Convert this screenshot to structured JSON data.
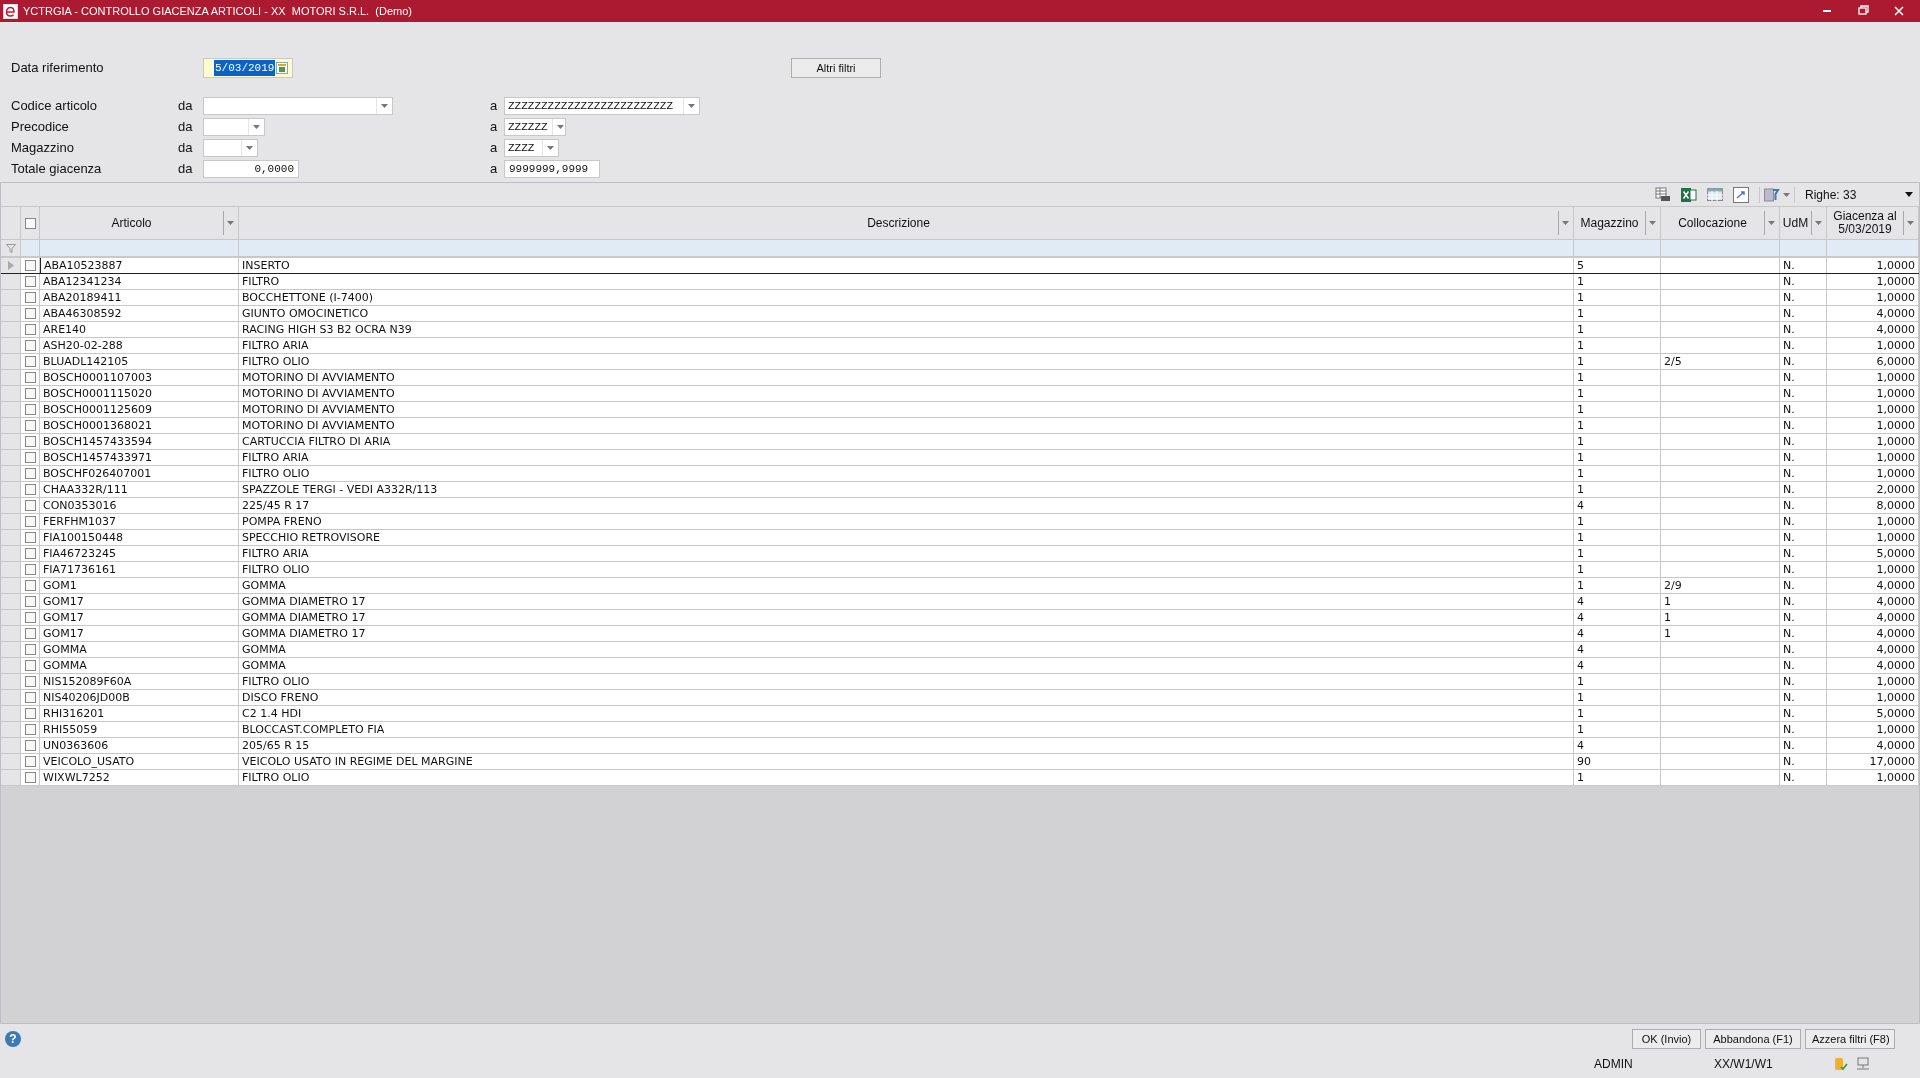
{
  "window": {
    "title": "YCTRGIA - CONTROLLO GIACENZA ARTICOLI - XX  MOTORI S.R.L.  (Demo)"
  },
  "date_field": {
    "label": "Data riferimento",
    "value": "5/03/2019"
  },
  "other_filters_button": "Altri filtri",
  "filters": [
    {
      "label": "Codice articolo",
      "from_label": "da",
      "from": {
        "kind": "combo"
      },
      "to_label": "a",
      "to": {
        "kind": "combo",
        "value": "ZZZZZZZZZZZZZZZZZZZZZZZZZ"
      }
    },
    {
      "label": "Precodice",
      "from_label": "da",
      "from": {
        "kind": "combo"
      },
      "to_label": "a",
      "to": {
        "kind": "combo",
        "value": "ZZZZZZ"
      }
    },
    {
      "label": "Magazzino",
      "from_label": "da",
      "from": {
        "kind": "combo"
      },
      "to_label": "a",
      "to": {
        "kind": "combo",
        "value": "ZZZZ"
      }
    },
    {
      "label": "Totale giacenza",
      "from_label": "da",
      "from": {
        "kind": "number",
        "value": "0,0000"
      },
      "to_label": "a",
      "to": {
        "kind": "text",
        "value": "9999999,9999"
      }
    }
  ],
  "grid_toolbar": {
    "rows_label": "Righe: 33"
  },
  "table": {
    "select_all_checked": false,
    "columns": [
      "Articolo",
      "Descrizione",
      "Magazzino",
      "Collocazione",
      "UdM",
      "Giacenza al 5/03/2019"
    ],
    "rows": [
      {
        "current": true,
        "checked": false,
        "cells": [
          "ABA10523887",
          "INSERTO",
          "5",
          "",
          "N.",
          "1,0000"
        ]
      },
      {
        "current": false,
        "checked": false,
        "cells": [
          "ABA12341234",
          "FILTRO",
          "1",
          "",
          "N.",
          "1,0000"
        ]
      },
      {
        "current": false,
        "checked": false,
        "cells": [
          "ABA20189411",
          "BOCCHETTONE (I-7400)",
          "1",
          "",
          "N.",
          "1,0000"
        ]
      },
      {
        "current": false,
        "checked": false,
        "cells": [
          "ABA46308592",
          "GIUNTO OMOCINETICO",
          "1",
          "",
          "N.",
          "4,0000"
        ]
      },
      {
        "current": false,
        "checked": false,
        "cells": [
          "ARE140",
          "RACING HIGH S3 B2 OCRA N39",
          "1",
          "",
          "N.",
          "4,0000"
        ]
      },
      {
        "current": false,
        "checked": false,
        "cells": [
          "ASH20-02-288",
          "FILTRO ARIA",
          "1",
          "",
          "N.",
          "1,0000"
        ]
      },
      {
        "current": false,
        "checked": false,
        "cells": [
          "BLUADL142105",
          "FILTRO OLIO",
          "1",
          "2/5",
          "N.",
          "6,0000"
        ]
      },
      {
        "current": false,
        "checked": false,
        "cells": [
          "BOSCH0001107003",
          "MOTORINO DI AVVIAMENTO",
          "1",
          "",
          "N.",
          "1,0000"
        ]
      },
      {
        "current": false,
        "checked": false,
        "cells": [
          "BOSCH0001115020",
          "MOTORINO DI AVVIAMENTO",
          "1",
          "",
          "N.",
          "1,0000"
        ]
      },
      {
        "current": false,
        "checked": false,
        "cells": [
          "BOSCH0001125609",
          "MOTORINO DI AVVIAMENTO",
          "1",
          "",
          "N.",
          "1,0000"
        ]
      },
      {
        "current": false,
        "checked": false,
        "cells": [
          "BOSCH0001368021",
          "MOTORINO DI AVVIAMENTO",
          "1",
          "",
          "N.",
          "1,0000"
        ]
      },
      {
        "current": false,
        "checked": false,
        "cells": [
          "BOSCH1457433594",
          "CARTUCCIA FILTRO DI ARIA",
          "1",
          "",
          "N.",
          "1,0000"
        ]
      },
      {
        "current": false,
        "checked": false,
        "cells": [
          "BOSCH1457433971",
          "FILTRO ARIA",
          "1",
          "",
          "N.",
          "1,0000"
        ]
      },
      {
        "current": false,
        "checked": false,
        "cells": [
          "BOSCHF026407001",
          "FILTRO OLIO",
          "1",
          "",
          "N.",
          "1,0000"
        ]
      },
      {
        "current": false,
        "checked": false,
        "cells": [
          "CHAA332R/111",
          "SPAZZOLE TERGI - VEDI A332R/113",
          "1",
          "",
          "N.",
          "2,0000"
        ]
      },
      {
        "current": false,
        "checked": false,
        "cells": [
          "CON0353016",
          "225/45 R 17",
          "4",
          "",
          "N.",
          "8,0000"
        ]
      },
      {
        "current": false,
        "checked": false,
        "cells": [
          "FERFHM1037",
          "POMPA FRENO",
          "1",
          "",
          "N.",
          "1,0000"
        ]
      },
      {
        "current": false,
        "checked": false,
        "cells": [
          "FIA100150448",
          "SPECCHIO RETROVISORE",
          "1",
          "",
          "N.",
          "1,0000"
        ]
      },
      {
        "current": false,
        "checked": false,
        "cells": [
          "FIA46723245",
          "FILTRO ARIA",
          "1",
          "",
          "N.",
          "5,0000"
        ]
      },
      {
        "current": false,
        "checked": false,
        "cells": [
          "FIA71736161",
          "FILTRO OLIO",
          "1",
          "",
          "N.",
          "1,0000"
        ]
      },
      {
        "current": false,
        "checked": false,
        "cells": [
          "GOM1",
          "GOMMA",
          "1",
          "2/9",
          "N.",
          "4,0000"
        ]
      },
      {
        "current": false,
        "checked": false,
        "cells": [
          "GOM17",
          "GOMMA DIAMETRO 17",
          "4",
          "1",
          "N.",
          "4,0000"
        ]
      },
      {
        "current": false,
        "checked": false,
        "cells": [
          "GOM17",
          "GOMMA DIAMETRO 17",
          "4",
          "1",
          "N.",
          "4,0000"
        ]
      },
      {
        "current": false,
        "checked": false,
        "cells": [
          "GOM17",
          "GOMMA DIAMETRO 17",
          "4",
          "1",
          "N.",
          "4,0000"
        ]
      },
      {
        "current": false,
        "checked": false,
        "cells": [
          "GOMMA",
          "GOMMA",
          "4",
          "",
          "N.",
          "4,0000"
        ]
      },
      {
        "current": false,
        "checked": false,
        "cells": [
          "GOMMA",
          "GOMMA",
          "4",
          "",
          "N.",
          "4,0000"
        ]
      },
      {
        "current": false,
        "checked": false,
        "cells": [
          "NIS152089F60A",
          "FILTRO OLIO",
          "1",
          "",
          "N.",
          "1,0000"
        ]
      },
      {
        "current": false,
        "checked": false,
        "cells": [
          "NIS40206JD00B",
          "DISCO FRENO",
          "1",
          "",
          "N.",
          "1,0000"
        ]
      },
      {
        "current": false,
        "checked": false,
        "cells": [
          "RHI316201",
          "C2 1.4 HDI",
          "1",
          "",
          "N.",
          "5,0000"
        ]
      },
      {
        "current": false,
        "checked": false,
        "cells": [
          "RHI55059",
          "BLOCCAST.COMPLETO FIA",
          "1",
          "",
          "N.",
          "1,0000"
        ]
      },
      {
        "current": false,
        "checked": false,
        "cells": [
          "UN0363606",
          "205/65 R 15",
          "4",
          "",
          "N.",
          "4,0000"
        ]
      },
      {
        "current": false,
        "checked": false,
        "cells": [
          "VEICOLO_USATO",
          "VEICOLO USATO IN REGIME DEL MARGINE",
          "90",
          "",
          "N.",
          "17,0000"
        ]
      },
      {
        "current": false,
        "checked": false,
        "cells": [
          "WIXWL7252",
          "FILTRO OLIO",
          "1",
          "",
          "N.",
          "1,0000"
        ]
      }
    ]
  },
  "help": "?",
  "footer_buttons": [
    "OK (Invio)",
    "Abbandona (F1)",
    "Azzera filtri (F8)"
  ],
  "status_bar": {
    "user": "ADMIN",
    "path": "XX/W1/W1"
  }
}
